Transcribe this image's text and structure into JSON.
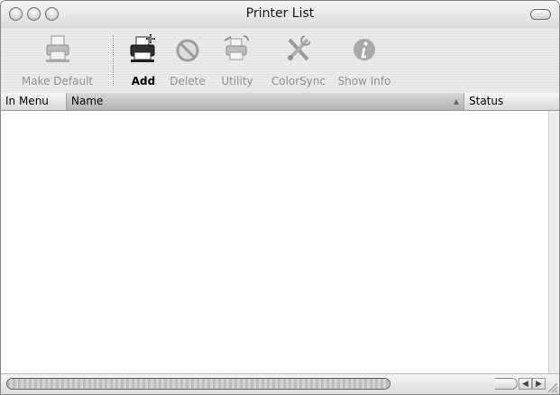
{
  "window": {
    "title": "Printer List"
  },
  "toolbar": {
    "make_default": {
      "label": "Make Default",
      "icon": "printer-default-icon"
    },
    "add": {
      "label": "Add",
      "icon": "printer-add-icon"
    },
    "delete": {
      "label": "Delete",
      "icon": "delete-prohibited-icon"
    },
    "utility": {
      "label": "Utility",
      "icon": "printer-utility-icon"
    },
    "colorsync": {
      "label": "ColorSync",
      "icon": "colorsync-tools-icon"
    },
    "show_info": {
      "label": "Show Info",
      "icon": "info-icon"
    }
  },
  "table": {
    "columns": [
      {
        "label": "In Menu"
      },
      {
        "label": "Name",
        "sort_indicator": "▲"
      },
      {
        "label": "Status"
      }
    ],
    "rows": []
  },
  "scrollbar": {
    "left_arrow": "◀",
    "right_arrow": "▶"
  }
}
